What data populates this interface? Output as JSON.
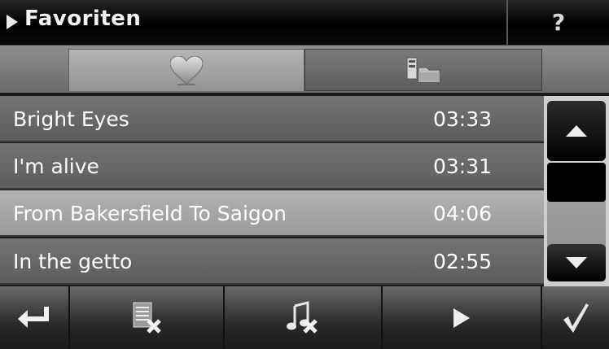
{
  "header": {
    "title": "Favoriten",
    "help_label": "?"
  },
  "tabs": [
    {
      "name": "favorites",
      "icon": "heart-icon",
      "selected": true
    },
    {
      "name": "folders",
      "icon": "folder-icon",
      "selected": false
    }
  ],
  "tracks": [
    {
      "title": "Bright Eyes",
      "duration": "03:33",
      "selected": false
    },
    {
      "title": "I'm alive",
      "duration": "03:31",
      "selected": false
    },
    {
      "title": "From Bakersfield To Saigon",
      "duration": "04:06",
      "selected": true
    },
    {
      "title": "In the getto",
      "duration": "02:55",
      "selected": false
    }
  ],
  "scrollbar": {
    "up_icon": "arrow-up-icon",
    "down_icon": "arrow-down-icon"
  },
  "toolbar": {
    "back_icon": "return-arrow-icon",
    "delete_list_icon": "delete-list-icon",
    "delete_song_icon": "delete-song-icon",
    "play_icon": "play-icon",
    "confirm_icon": "checkmark-icon"
  },
  "colors": {
    "selected_row": "#a8a8a8",
    "row": "#676767",
    "titlebar": "#000000"
  }
}
